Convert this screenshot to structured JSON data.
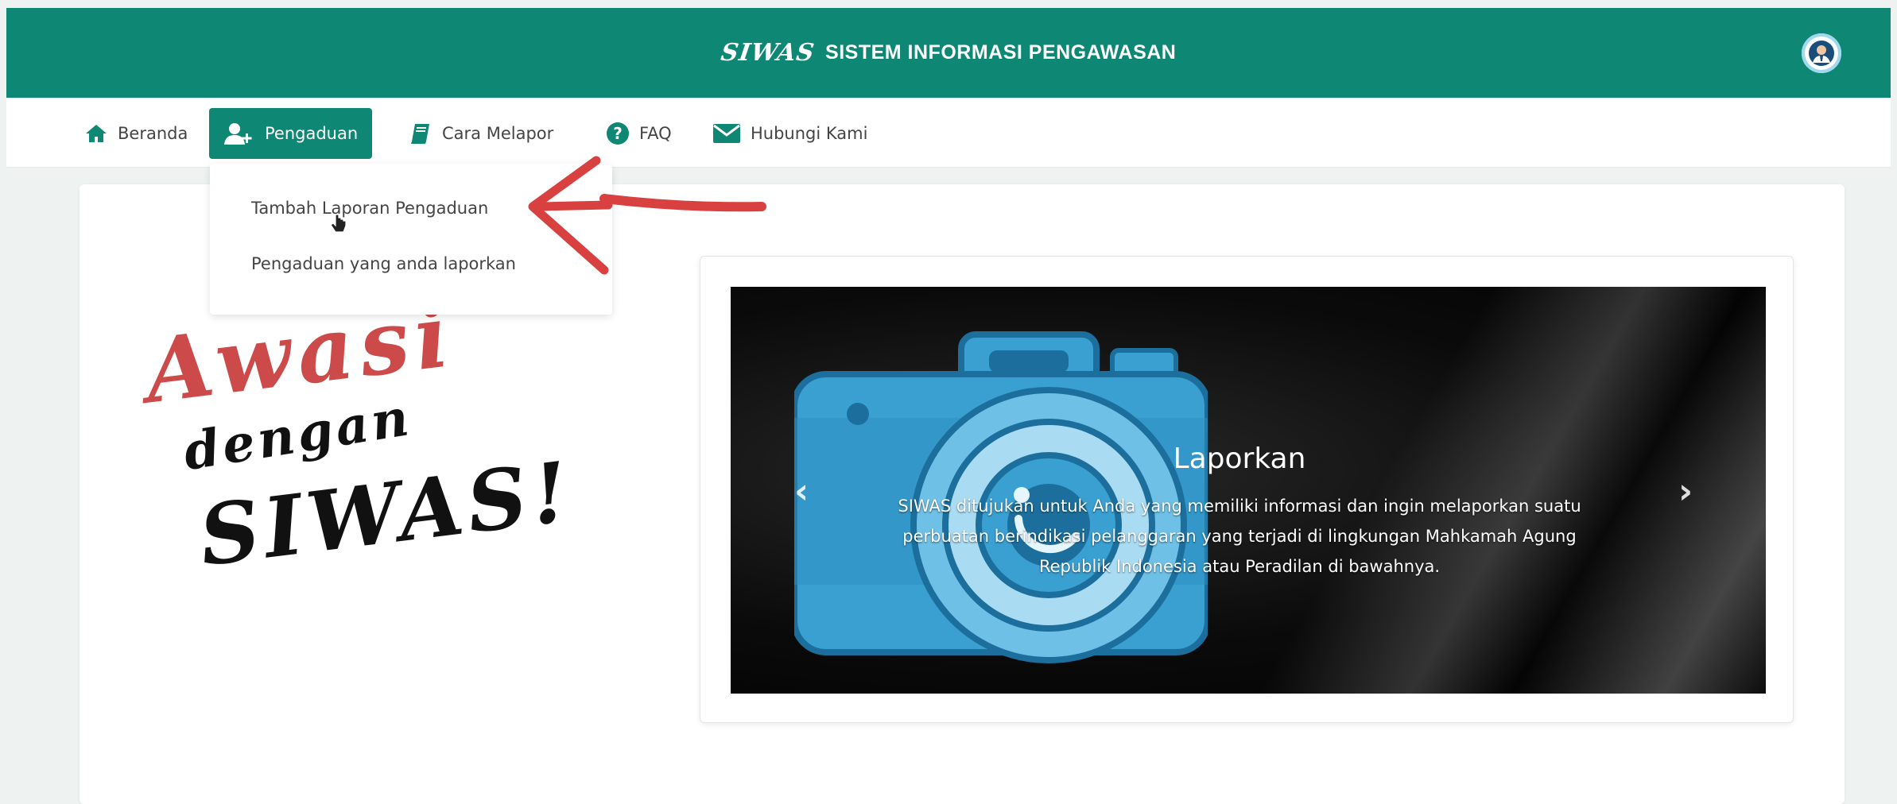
{
  "header": {
    "logo_text": "SIWAS",
    "title": "SISTEM INFORMASI PENGAWASAN",
    "avatar_icon": "user-avatar-icon"
  },
  "nav": {
    "items": [
      {
        "label": "Beranda",
        "icon": "home-icon"
      },
      {
        "label": "Pengaduan",
        "icon": "user-plus-icon",
        "active": true
      },
      {
        "label": "Cara Melapor",
        "icon": "book-icon"
      },
      {
        "label": "FAQ",
        "icon": "question-circle-icon"
      },
      {
        "label": "Hubungi Kami",
        "icon": "envelope-icon"
      }
    ]
  },
  "dropdown": {
    "items": [
      {
        "label": "Tambah Laporan Pengaduan"
      },
      {
        "label": "Pengaduan yang anda laporkan"
      }
    ]
  },
  "hero_art": {
    "line1": "Awasi",
    "line2": "dengan",
    "line3": "SIWAS!"
  },
  "carousel": {
    "slide": {
      "title": "Laporkan",
      "text": "SIWAS ditujukan untuk Anda yang memiliki informasi dan ingin melaporkan suatu perbuatan berindikasi pelanggaran yang terjadi di lingkungan Mahkamah Agung Republik Indonesia atau Peradilan di bawahnya.",
      "image_icon": "camera-icon"
    },
    "prev_icon": "chevron-left-icon",
    "next_icon": "chevron-right-icon"
  },
  "colors": {
    "primary": "#0e8774",
    "annotation": "#d94040",
    "accent_red": "#cc4a4a"
  }
}
